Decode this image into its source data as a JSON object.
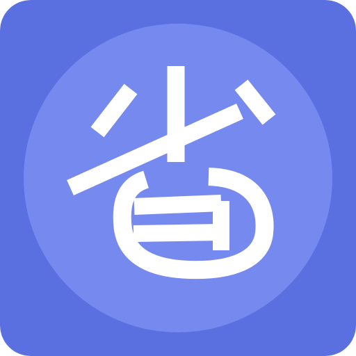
{
  "icon": {
    "glyph": "省",
    "colors": {
      "tile": "#5a6fe0",
      "circle": "#7689ef",
      "glyph": "#ffffff"
    }
  }
}
